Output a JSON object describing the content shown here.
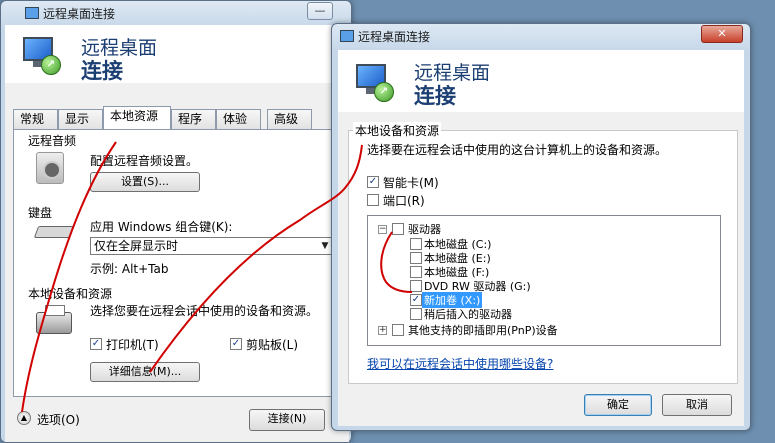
{
  "back_window": {
    "title": "远程桌面连接",
    "header_line1": "远程桌面",
    "header_line2": "连接",
    "tabs": [
      {
        "label": "常规"
      },
      {
        "label": "显示"
      },
      {
        "label": "本地资源"
      },
      {
        "label": "程序"
      },
      {
        "label": "体验"
      },
      {
        "label": "高级"
      }
    ],
    "audio": {
      "title": "远程音频",
      "desc": "配置远程音频设置。",
      "button": "设置(S)..."
    },
    "keyboard": {
      "title": "键盘",
      "desc": "应用 Windows 组合键(K):",
      "value": "仅在全屏显示时",
      "example": "示例: Alt+Tab"
    },
    "devices": {
      "title": "本地设备和资源",
      "desc": "选择您要在远程会话中使用的设备和资源。",
      "printer": "打印机(T)",
      "clipboard": "剪贴板(L)",
      "more_button": "详细信息(M)..."
    },
    "options": "选项(O)",
    "connect": "连接(N)"
  },
  "front_window": {
    "title": "远程桌面连接",
    "close_glyph": "✕",
    "header_line1": "远程桌面",
    "header_line2": "连接",
    "group_title": "本地设备和资源",
    "group_desc": "选择要在远程会话中使用的这台计算机上的设备和资源。",
    "smartcard": "智能卡(M)",
    "port": "端口(R)",
    "tree": {
      "drives": "驱动器",
      "items": [
        {
          "label": "本地磁盘 (C:)",
          "checked": false
        },
        {
          "label": "本地磁盘 (E:)",
          "checked": false
        },
        {
          "label": "本地磁盘 (F:)",
          "checked": false
        },
        {
          "label": "DVD RW 驱动器 (G:)",
          "checked": false
        },
        {
          "label": "新加卷 (X:)",
          "checked": true
        },
        {
          "label": "稍后插入的驱动器",
          "checked": false
        }
      ],
      "pnp": "其他支持的即插即用(PnP)设备"
    },
    "link": "我可以在远程会话中使用哪些设备?",
    "ok": "确定",
    "cancel": "取消"
  },
  "titlebar_buttons": {
    "minimize": "—",
    "maximize": "□",
    "close": "✕"
  },
  "annotation_color": "#d10000"
}
